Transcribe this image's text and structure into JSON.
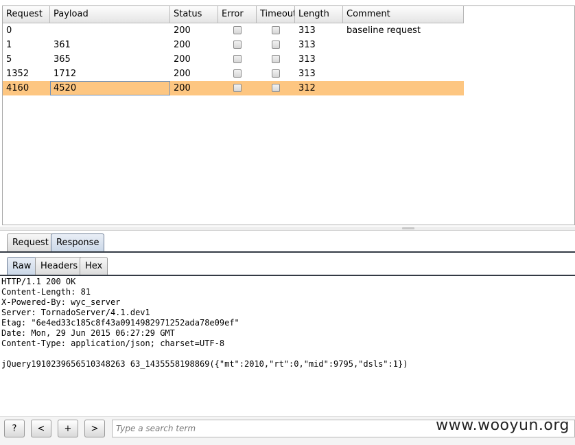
{
  "table": {
    "columns": [
      "Request",
      "Payload",
      "Status",
      "Error",
      "Timeout",
      "Length",
      "Comment"
    ],
    "rows": [
      {
        "request": "0",
        "payload": "",
        "status": "200",
        "error": false,
        "timeout": false,
        "length": "313",
        "comment": "baseline request",
        "selected": false
      },
      {
        "request": "1",
        "payload": "361",
        "status": "200",
        "error": false,
        "timeout": false,
        "length": "313",
        "comment": "",
        "selected": false
      },
      {
        "request": "5",
        "payload": "365",
        "status": "200",
        "error": false,
        "timeout": false,
        "length": "313",
        "comment": "",
        "selected": false
      },
      {
        "request": "1352",
        "payload": "1712",
        "status": "200",
        "error": false,
        "timeout": false,
        "length": "313",
        "comment": "",
        "selected": false
      },
      {
        "request": "4160",
        "payload": "4520",
        "status": "200",
        "error": false,
        "timeout": false,
        "length": "312",
        "comment": "",
        "selected": true
      }
    ]
  },
  "outer_tabs": [
    {
      "label": "Request",
      "active": false
    },
    {
      "label": "Response",
      "active": true
    }
  ],
  "inner_tabs": [
    {
      "label": "Raw",
      "active": true
    },
    {
      "label": "Headers",
      "active": false
    },
    {
      "label": "Hex",
      "active": false
    }
  ],
  "response": {
    "lines": [
      "HTTP/1.1 200 OK",
      "Content-Length: 81",
      "X-Powered-By: wyc_server",
      "Server: TornadoServer/4.1.dev1",
      "Etag: \"6e4ed33c185c8f43a0914982971252ada78e09ef\"",
      "Date: Mon, 29 Jun 2015 06:27:29 GMT",
      "Content-Type: application/json; charset=UTF-8",
      "",
      "jQuery1910239656510348263 63_1435558198869({\"mt\":2010,\"rt\":0,\"mid\":9795,\"dsls\":1})"
    ]
  },
  "bottombar": {
    "help_label": "?",
    "prev_label": "<",
    "add_label": "+",
    "next_label": ">",
    "search_placeholder": "Type a search term"
  },
  "watermark": "www.wooyun.org",
  "colors": {
    "selected_row": "#fdc681",
    "tab_underline": "#333a44"
  }
}
